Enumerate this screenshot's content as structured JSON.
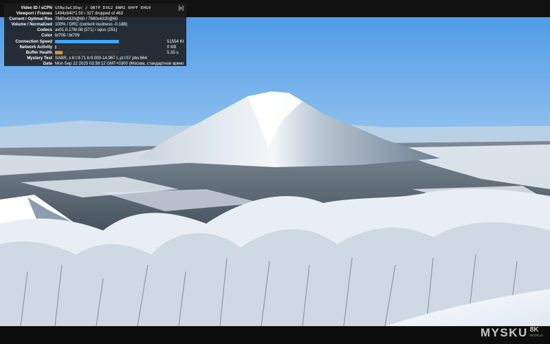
{
  "stats": {
    "close_label": "[x]",
    "rows": [
      {
        "label": "Video ID / sCPN",
        "value": "G5Rp3wC3Dqc  /  QN7P D3G2 8NM2 6HPF EHG0"
      },
      {
        "label": "Viewport / Frames",
        "value": "1494x840*1.50 / 327 dropped of 463"
      },
      {
        "label": "Current / Optimal Res",
        "value": "7680x4320@60 / 7680x4320@60"
      },
      {
        "label": "Volume / Normalized",
        "value": "100% / DRC (content loudness -0.1dB)"
      },
      {
        "label": "Codecs",
        "value": "av01.0.17M.08 (571) / opus (251)"
      },
      {
        "label": "Color",
        "value": "bt709 / bt709"
      },
      {
        "label": "Connection Speed",
        "value": "51554 Kbps"
      },
      {
        "label": "Network Activity",
        "value": "0 KB"
      },
      {
        "label": "Buffer Health",
        "value": "5.35 s"
      },
      {
        "label": "Mystery Text",
        "value": "SABR, s:8 t:9.71 b:0.000-14.967 L pl:i:57 pbs:664"
      },
      {
        "label": "Date",
        "value": "Mon Sep 22 2025 03:38:12 GMT+0300 (Москва, стандартное время)"
      }
    ],
    "connection_fill_pct": 100,
    "network_fill_pct": 2,
    "buffer_fill_pct": 12,
    "bar_colors": {
      "connection": "#3ea6ff",
      "network": "#3ea6ff",
      "buffer": "#e58a2e"
    }
  },
  "watermark": {
    "brand": "MYSKU",
    "badge": "8K",
    "sub": "WORLD"
  }
}
